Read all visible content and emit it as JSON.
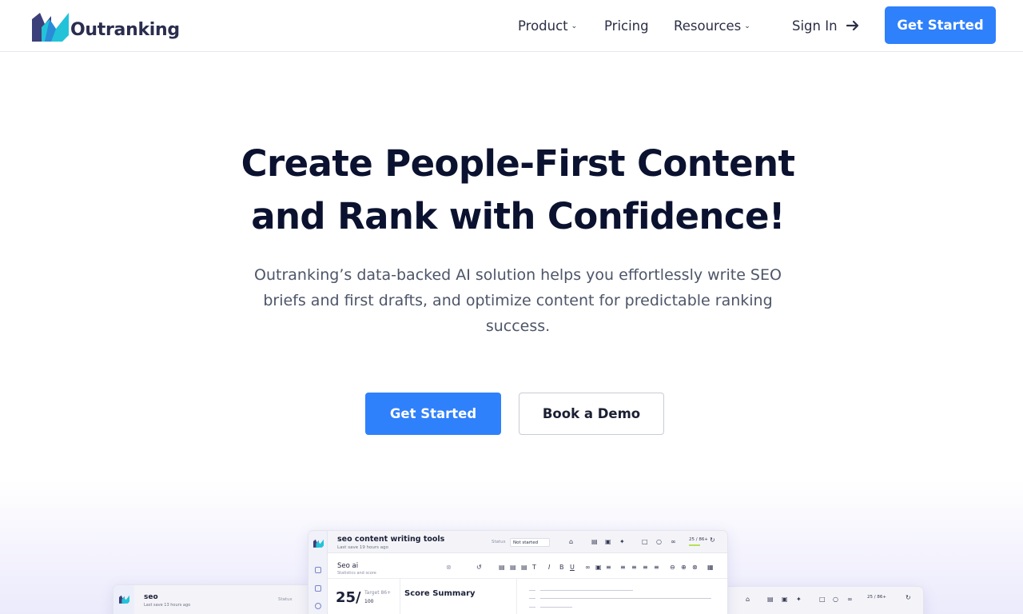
{
  "brand": {
    "name": "Outranking",
    "primary_color": "#2f80fb"
  },
  "nav": {
    "items": [
      {
        "label": "Product",
        "has_dropdown": true
      },
      {
        "label": "Pricing",
        "has_dropdown": false
      },
      {
        "label": "Resources",
        "has_dropdown": true
      }
    ],
    "sign_in": "Sign In",
    "cta": "Get Started"
  },
  "hero": {
    "title_line1": "Create People-First Content",
    "title_line2": "and Rank with Confidence!",
    "subtitle": "Outranking’s data-backed AI solution helps you effortlessly write SEO briefs and first drafts, and optimize content for predictable ranking success.",
    "primary_button": "Get Started",
    "secondary_button": "Book a Demo"
  },
  "app_preview": {
    "doc_title": "seo content writing tools",
    "doc_meta": "Last save 19 hours ago",
    "status_label": "Status",
    "status_value": "Not started",
    "score_chip": "25 / 86+",
    "keyword": "Seo ai",
    "keyword_sub": "Statistics and score",
    "score": "25/",
    "target_label": "Target 86+",
    "target_value": "100",
    "panel_title": "Score Summary",
    "left_title": "seo",
    "left_meta": "Last save 13 hours ago",
    "left_status": "Status",
    "right_score": "25 / 86+"
  }
}
